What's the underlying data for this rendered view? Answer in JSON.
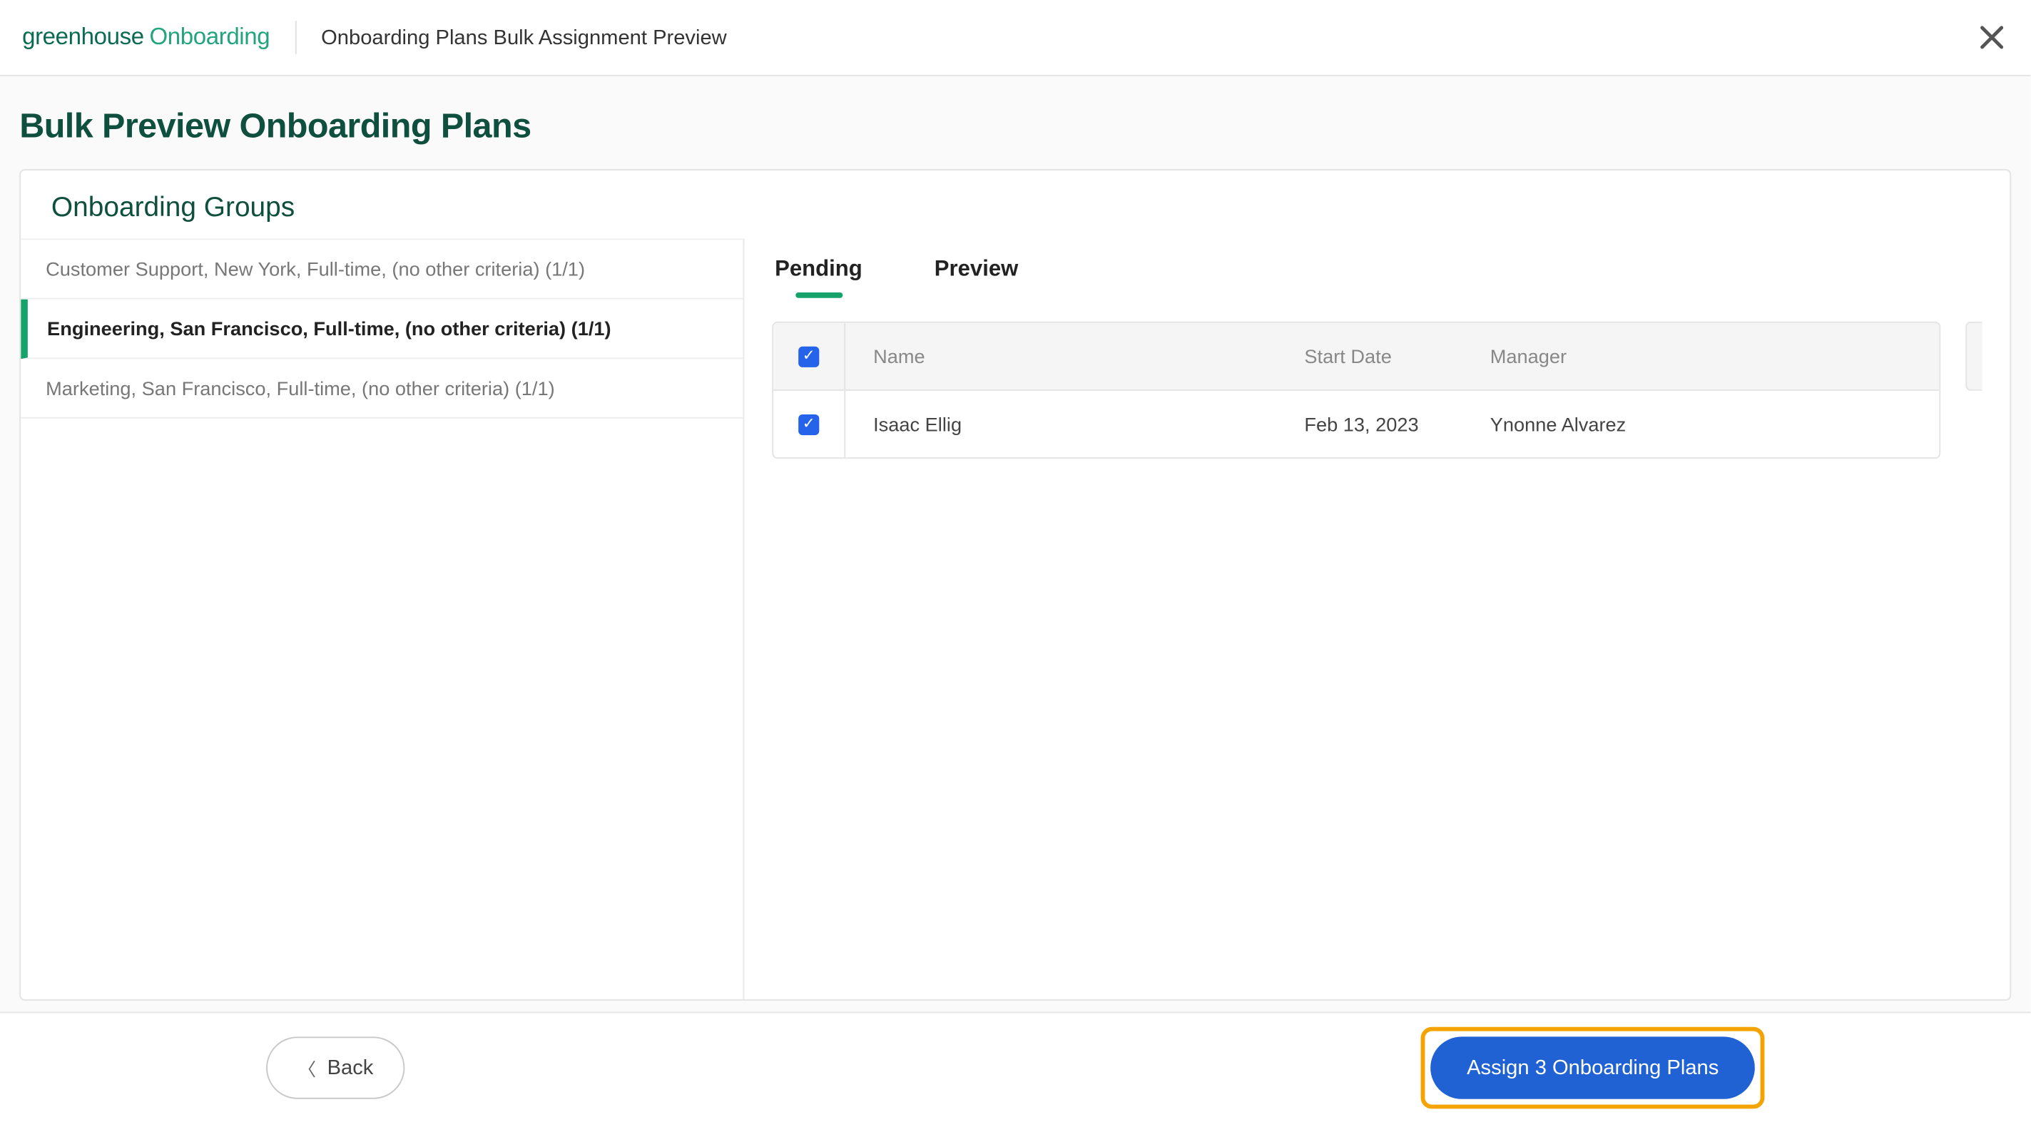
{
  "header": {
    "logo_primary": "greenhouse",
    "logo_secondary": "Onboarding",
    "breadcrumb": "Onboarding Plans Bulk Assignment Preview"
  },
  "page": {
    "title": "Bulk Preview Onboarding Plans",
    "panel_title": "Onboarding Groups"
  },
  "sidebar": {
    "items": [
      {
        "label": "Customer Support, New York, Full-time, (no other criteria) (1/1)",
        "active": false
      },
      {
        "label": "Engineering, San Francisco, Full-time, (no other criteria) (1/1)",
        "active": true
      },
      {
        "label": "Marketing, San Francisco, Full-time, (no other criteria) (1/1)",
        "active": false
      }
    ]
  },
  "tabs": {
    "items": [
      {
        "label": "Pending",
        "active": true
      },
      {
        "label": "Preview",
        "active": false
      }
    ]
  },
  "table": {
    "columns": {
      "name": "Name",
      "start": "Start Date",
      "manager": "Manager"
    },
    "rows": [
      {
        "checked": true,
        "name": "Isaac Ellig",
        "start": "Feb 13, 2023",
        "manager": "Ynonne Alvarez"
      }
    ]
  },
  "footer": {
    "back_label": "Back",
    "assign_label": "Assign 3 Onboarding Plans"
  }
}
